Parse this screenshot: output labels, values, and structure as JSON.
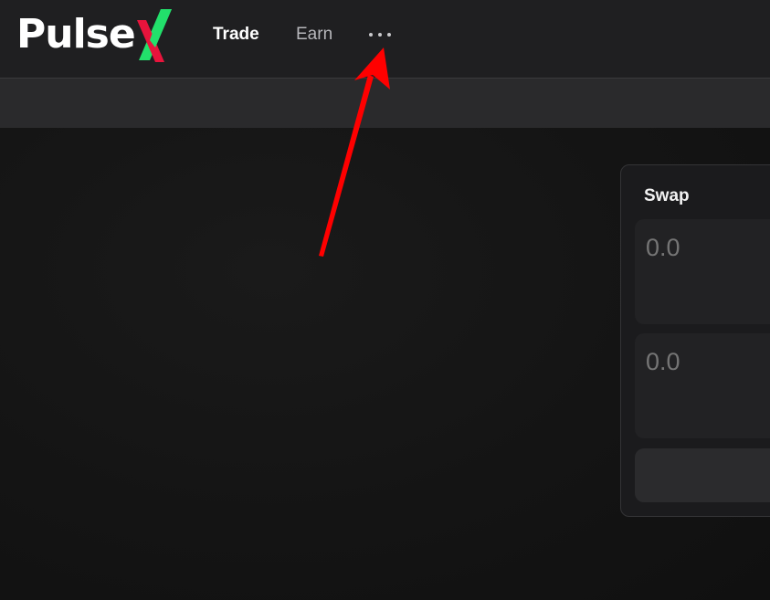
{
  "header": {
    "logo": {
      "text": "Pulse",
      "x_colors": {
        "green": "#22e06b",
        "red": "#e8143c"
      }
    },
    "nav": [
      {
        "label": "Trade",
        "active": true
      },
      {
        "label": "Earn",
        "active": false
      }
    ],
    "more_icon": "more-horizontal-icon"
  },
  "swap": {
    "title": "Swap",
    "input_amount": "0.0",
    "output_amount": "0.0",
    "action_label": ""
  },
  "annotation": {
    "arrow_color": "#ff0000"
  },
  "colors": {
    "topbar": "#1f1f21",
    "subbar": "#2a2a2c",
    "background": "#121212",
    "card": "#1b1b1d"
  }
}
